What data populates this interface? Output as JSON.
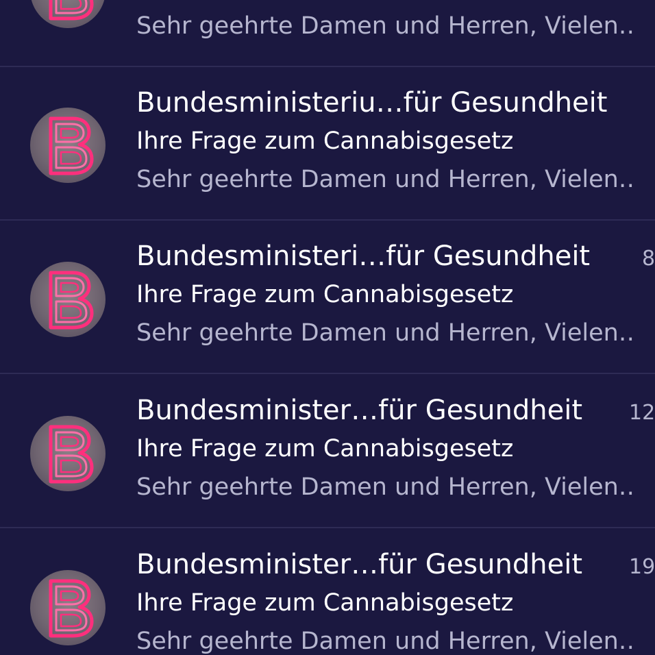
{
  "colors": {
    "background": "#1b1840",
    "divider": "#2e2b55",
    "primary_text": "#ffffff",
    "secondary_text": "#b6b6cf",
    "avatar_neon": "#ff2f7d"
  },
  "avatar": {
    "icon": "neon-letter-b-avatar",
    "letter": "B"
  },
  "messages": [
    {
      "sender": "",
      "subject": "",
      "preview": "Sehr geehrte Damen und Herren, Vielen…",
      "date": ""
    },
    {
      "sender": "Bundesministeriu…für Gesundheit",
      "subject": "Ihre Frage zum Cannabisgesetz",
      "preview": "Sehr geehrte Damen und Herren, Vielen…",
      "date": ""
    },
    {
      "sender": "Bundesministeri…für Gesundheit",
      "subject": "Ihre Frage zum Cannabisgesetz",
      "preview": "Sehr geehrte Damen und Herren, Vielen…",
      "date": "8"
    },
    {
      "sender": "Bundesminister…für Gesundheit",
      "subject": "Ihre Frage zum Cannabisgesetz",
      "preview": "Sehr geehrte Damen und Herren, Vielen…",
      "date": "12"
    },
    {
      "sender": "Bundesminister…für Gesundheit",
      "subject": "Ihre Frage zum Cannabisgesetz",
      "preview": "Sehr geehrte Damen und Herren, Vielen…",
      "date": "19"
    }
  ]
}
